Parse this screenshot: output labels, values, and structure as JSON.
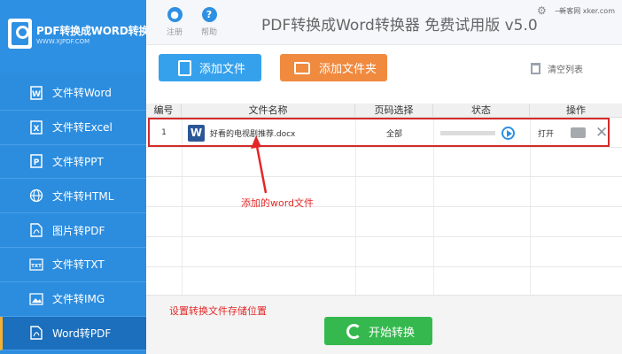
{
  "brand": {
    "title": "PDF转换成WORD转换器",
    "subtitle": "WWW.XJPDF.COM"
  },
  "sidebar": {
    "items": [
      {
        "label": "文件转Word",
        "icon": "word-file-icon"
      },
      {
        "label": "文件转Excel",
        "icon": "excel-file-icon"
      },
      {
        "label": "文件转PPT",
        "icon": "ppt-file-icon"
      },
      {
        "label": "文件转HTML",
        "icon": "globe-icon"
      },
      {
        "label": "图片转PDF",
        "icon": "pdf-file-icon"
      },
      {
        "label": "文件转TXT",
        "icon": "txt-file-icon"
      },
      {
        "label": "文件转IMG",
        "icon": "image-icon"
      },
      {
        "label": "Word转PDF",
        "icon": "pdf-file-icon"
      }
    ]
  },
  "topbar": {
    "register_label": "注册",
    "help_label": "帮助",
    "title": "PDF转换成Word转换器 免费试用版 v5.0",
    "watermark": "新客网 xker.com"
  },
  "toolbar": {
    "add_file_label": "添加文件",
    "add_folder_label": "添加文件夹",
    "clear_list_label": "清空列表"
  },
  "table": {
    "columns": [
      "编号",
      "文件名称",
      "页码选择",
      "状态",
      "操作"
    ],
    "rows": [
      {
        "index": "1",
        "file_name": "好看的电视剧推荐.docx",
        "page_selection": "全部",
        "open_label": "打开"
      }
    ]
  },
  "annotations": {
    "word_file_note": "添加的word文件",
    "output_location_note": "设置转换文件存储位置"
  },
  "bottom": {
    "start_label": "开始转换"
  },
  "colors": {
    "sidebar_blue": "#2d8ee0",
    "active_item": "#1b6fbd",
    "add_file_button": "#35a1ec",
    "add_folder_button": "#f08a3f",
    "start_button": "#35b94e",
    "annotation_red": "#e32727"
  }
}
